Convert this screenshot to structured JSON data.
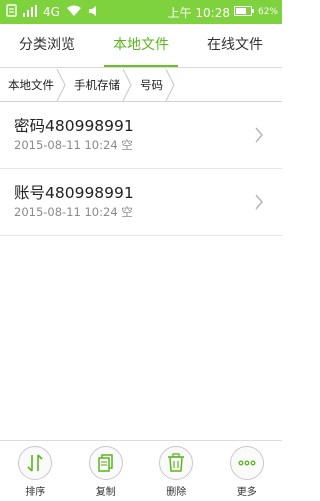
{
  "status": {
    "network": "4G",
    "time": "上午 10:28",
    "battery": "62%",
    "accent": "#7ed23e"
  },
  "tabs": [
    {
      "label": "分类浏览",
      "active": false
    },
    {
      "label": "本地文件",
      "active": true
    },
    {
      "label": "在线文件",
      "active": false
    }
  ],
  "breadcrumb": [
    "本地文件",
    "手机存储",
    "号码"
  ],
  "files": [
    {
      "name": "密码480998991",
      "date": "2015-08-11 10:24",
      "size": "空"
    },
    {
      "name": "账号480998991",
      "date": "2015-08-11 10:24",
      "size": "空"
    }
  ],
  "actions": [
    {
      "label": "排序",
      "icon": "sort-icon"
    },
    {
      "label": "复制",
      "icon": "copy-icon"
    },
    {
      "label": "删除",
      "icon": "trash-icon"
    },
    {
      "label": "更多",
      "icon": "more-icon"
    }
  ],
  "colors": {
    "tab_active": "#5cb51f",
    "icon_green": "#5cb51f"
  }
}
